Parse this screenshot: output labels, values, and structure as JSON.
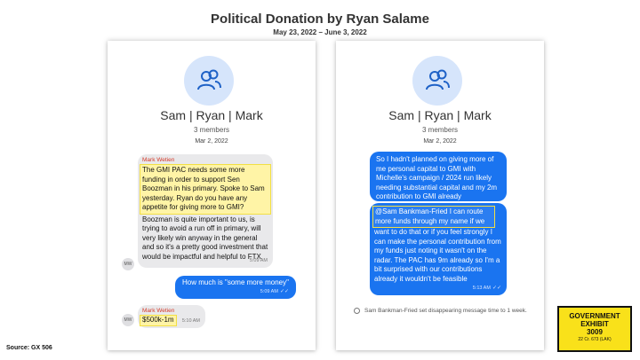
{
  "header": {
    "title": "Political Donation by Ryan Salame",
    "date_range": "May 23, 2022 – June 3, 2022"
  },
  "left_panel": {
    "group_name": "Sam | Ryan | Mark",
    "members": "3 members",
    "date": "Mar 2, 2022",
    "msg1": {
      "sender": "Mark Wetien",
      "highlighted_text": "The GMI PAC needs some more funding in order to support Sen Boozman in his primary. Spoke to Sam yesterday. Ryan do you have any appetite for giving more to GMI?",
      "text": "Boozman is quite important to us, is trying to avoid a run off in primary, will very likely win anyway in the general and so it's a pretty good investment that would be impactful and helpful to FTX",
      "time": "5:09 AM",
      "avatar": "MW"
    },
    "msg2": {
      "text": "How much is \"some more money\"",
      "time": "5:09 AM"
    },
    "msg3": {
      "sender": "Mark Wetien",
      "text": "$500k-1m",
      "time": "5:10 AM",
      "avatar": "MW"
    }
  },
  "right_panel": {
    "group_name": "Sam | Ryan | Mark",
    "members": "3 members",
    "date": "Mar 2, 2022",
    "msg1": {
      "text": "So I hadn't planned on giving more of me personal capital to GMI with Michelle's campaign / 2024 run likely needing substantial capital and my 2m contribution to GMI already"
    },
    "msg2": {
      "highlighted_text": "@Sam Bankman-Fried I can route more funds through my name if we",
      "text": "want to do that or if you feel strongly I can make the personal contribution from my funds just noting it wasn't on the radar. The PAC has 9m already so I'm a bit surprised with our contributions already it wouldn't be feasible",
      "time": "5:13 AM"
    },
    "system_message": "Sam Bankman-Fried set disappearing message time to 1 week."
  },
  "footer": {
    "source": "Source: GX 506",
    "exhibit_line1": "GOVERNMENT",
    "exhibit_line2": "EXHIBIT",
    "exhibit_number": "3009",
    "exhibit_case": "22 Cr. 673 (LAK)"
  },
  "colors": {
    "blue_bubble": "#1a74f0",
    "gray_bubble": "#e9e9eb",
    "highlight": "#f2df44",
    "exhibit_bg": "#f9e11a",
    "sender": "#d43b2a"
  },
  "icons": {
    "group_avatar": "people-icon",
    "read_receipt": "double-check-icon",
    "timer": "clock-icon"
  }
}
